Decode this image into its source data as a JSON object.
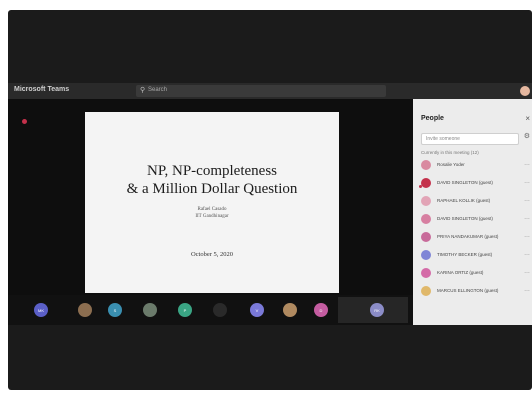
{
  "app": {
    "title": "Microsoft Teams",
    "search_placeholder": "Search"
  },
  "slide": {
    "title_line1": "NP, NP-completeness",
    "title_line2": "& a Million Dollar Question",
    "author_line1": "Rafael Casado",
    "author_line2": "IIT Gandhinagar",
    "date": "October 5, 2020"
  },
  "gallery": {
    "participants": [
      {
        "initials": "MK",
        "color": "#5b5fc7"
      },
      {
        "initials": "",
        "color": "#8c6e50"
      },
      {
        "initials": "S",
        "color": "#3a8fb0"
      },
      {
        "initials": "",
        "color": "#6b7b6b"
      },
      {
        "initials": "P",
        "color": "#3aa584"
      },
      {
        "initials": "",
        "color": "#2a2a2a"
      },
      {
        "initials": "V",
        "color": "#7a79d8"
      },
      {
        "initials": "",
        "color": "#b08a60"
      },
      {
        "initials": "D",
        "color": "#c45ca0"
      },
      {
        "initials": "RK",
        "color": "#8b8cc7"
      }
    ]
  },
  "people": {
    "title": "People",
    "invite_placeholder": "Invite someone",
    "section_header": "Currently in this meeting (12)",
    "participants": [
      {
        "name": "Rosalie Yoder",
        "color": "#d98aa0"
      },
      {
        "name": "DAVID SINGLETON (guest)",
        "color": "#c4314b"
      },
      {
        "name": "RAPHAEL KOLLIK (guest)",
        "color": "#e2a4b6"
      },
      {
        "name": "DAVID SINGLETON (guest)",
        "color": "#d77fa1"
      },
      {
        "name": "PRIYA NANDAKUMAR (guest)",
        "color": "#c86b9a"
      },
      {
        "name": "TIMOTHY BECKER (guest)",
        "color": "#7f85d6"
      },
      {
        "name": "KARINA ORTIZ (guest)",
        "color": "#d46aa7"
      },
      {
        "name": "MARCUS ELLINGTON (guest)",
        "color": "#e0b86a"
      }
    ]
  }
}
